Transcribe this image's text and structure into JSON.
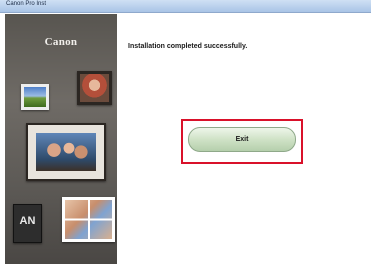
{
  "window": {
    "title": "Canon Pro Inst"
  },
  "sidebar": {
    "brand": "Canon",
    "mono_mark": "AN"
  },
  "main": {
    "message": "Installation completed successfully.",
    "exit_label": "Exit"
  },
  "colors": {
    "highlight": "#d9112a",
    "button": "#cfe2c6",
    "sidebar": "#5f5b57"
  }
}
